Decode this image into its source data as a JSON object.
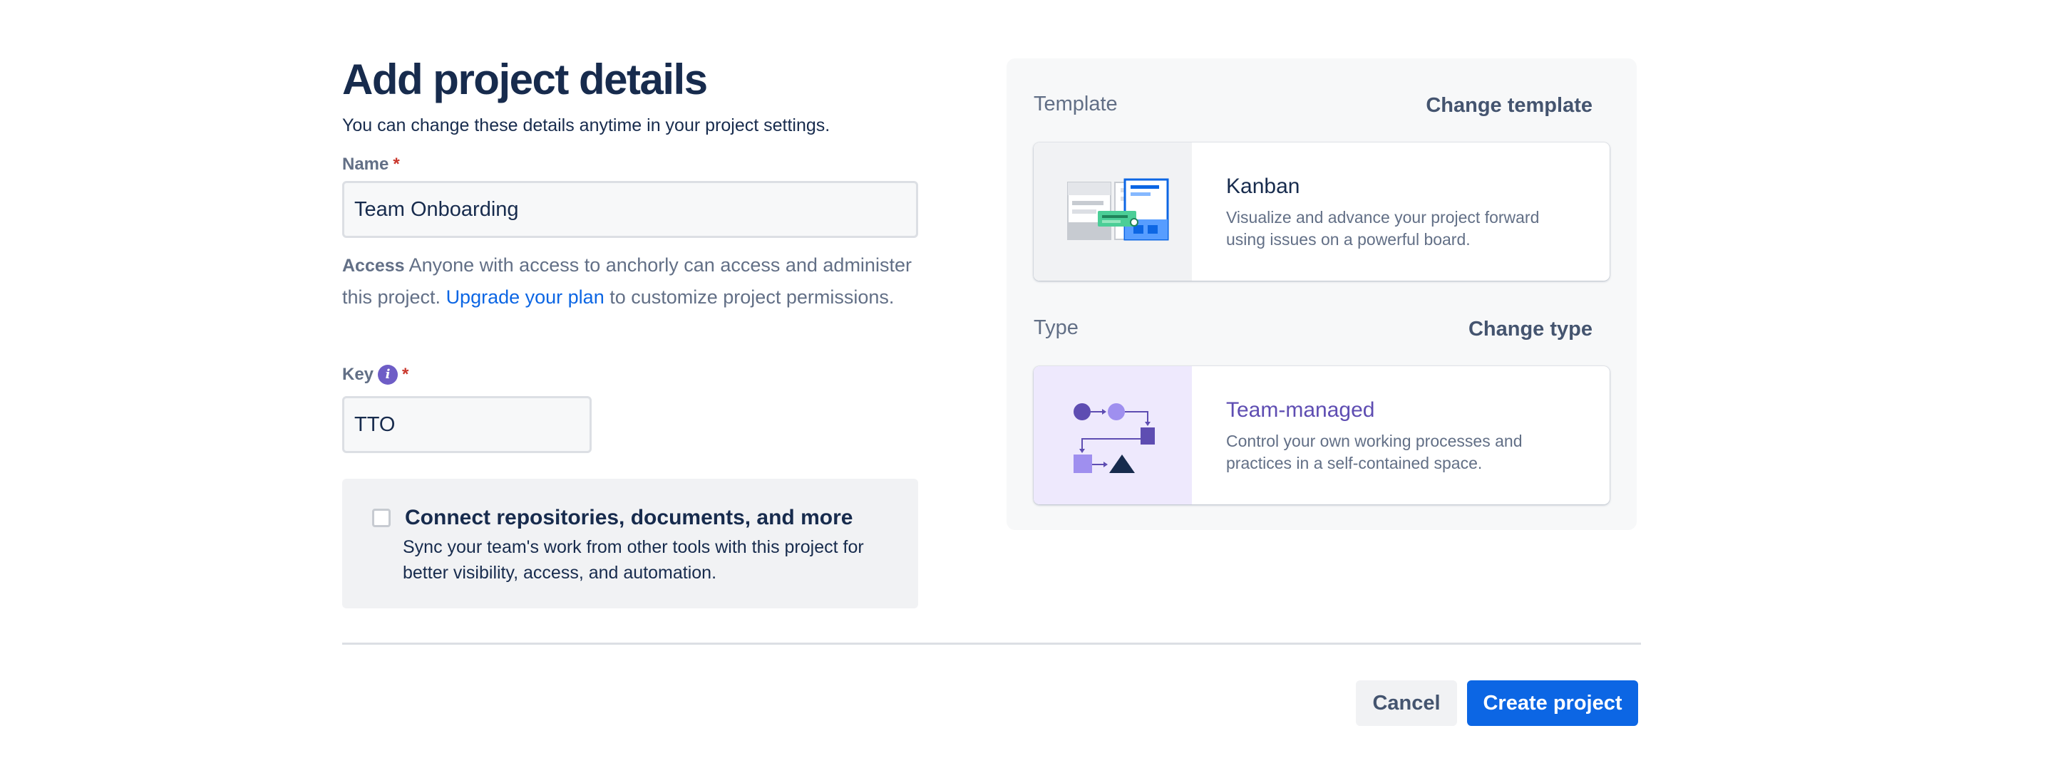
{
  "header": {
    "title": "Add project details",
    "subtitle": "You can change these details anytime in your project settings."
  },
  "name_field": {
    "label": "Name",
    "required_mark": "*",
    "value": "Team Onboarding"
  },
  "access": {
    "label": "Access",
    "text_before": " Anyone with access to anchorly can access and administer this project. ",
    "link_text": "Upgrade your plan",
    "text_after": " to customize project permissions."
  },
  "key_field": {
    "label": "Key",
    "info_icon": "info-icon",
    "info_glyph": "i",
    "required_mark": "*",
    "value": "TTO"
  },
  "connect": {
    "checked": false,
    "title": "Connect repositories, documents, and more",
    "description": "Sync your team's work from other tools with this project for better visibility, access, and automation."
  },
  "template": {
    "section_label": "Template",
    "change_label": "Change template",
    "name": "Kanban",
    "description": "Visualize and advance your project forward using issues on a powerful board."
  },
  "type": {
    "section_label": "Type",
    "change_label": "Change type",
    "name": "Team-managed",
    "description": "Control your own working processes and practices in a self-contained space."
  },
  "footer": {
    "cancel_label": "Cancel",
    "create_label": "Create project"
  },
  "colors": {
    "primary": "#0c66e4",
    "text": "#172b4d",
    "subtle_text": "#626f86",
    "required": "#c9372c",
    "team_managed_accent": "#5e4db2",
    "team_managed_bg": "#eee9fd"
  }
}
